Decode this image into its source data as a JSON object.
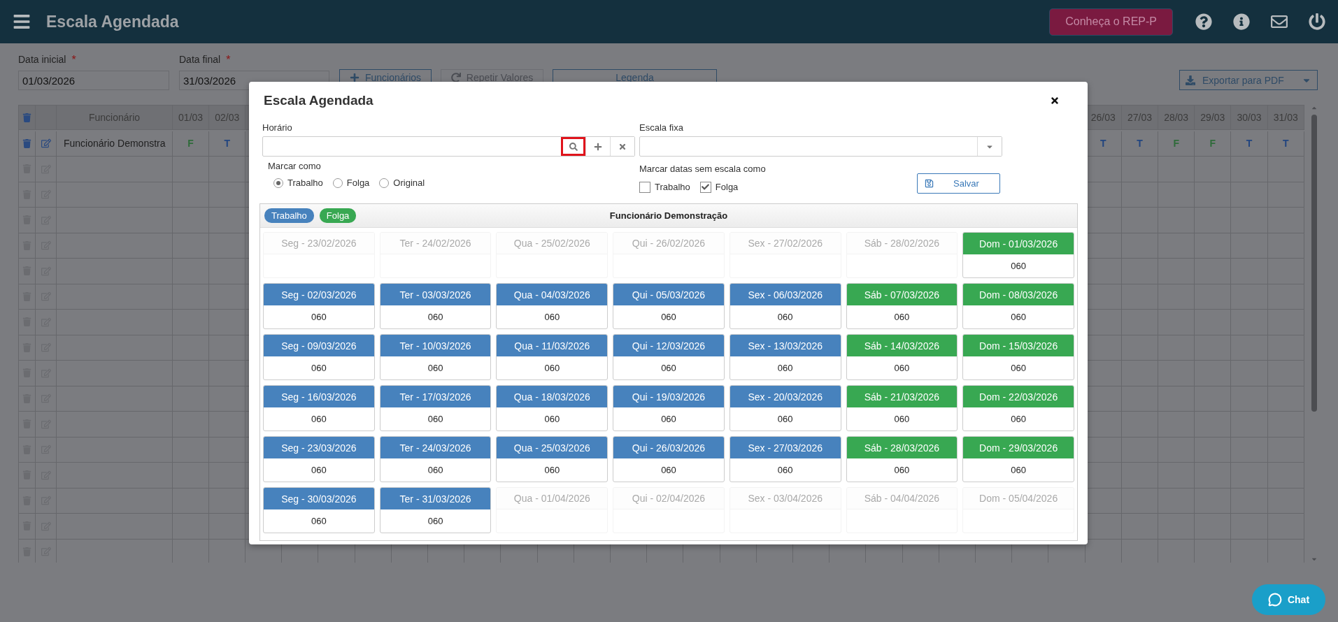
{
  "topbar": {
    "title": "Escala Agendada",
    "promo_button": "Conheça o REP-P"
  },
  "filters": {
    "fields": [
      {
        "label": "Data inicial",
        "required_mark": "*",
        "value": "01/03/2026"
      },
      {
        "label": "Data final",
        "required_mark": "*",
        "value": "31/03/2026"
      }
    ],
    "buttons": [
      {
        "label": "Funcionários",
        "kind": "add",
        "disabled": false
      },
      {
        "label": "Repetir Valores",
        "kind": "repeat",
        "disabled": true
      },
      {
        "label": "Legenda",
        "kind": "plain",
        "disabled": false
      }
    ],
    "export_button": "Exportar para PDF"
  },
  "table": {
    "name_column": "Funcionário",
    "leading_columns": [
      "01/03",
      "02/03"
    ],
    "trailing_columns": [
      "26/03",
      "27/03",
      "28/03",
      "29/03",
      "30/03",
      "31/03"
    ],
    "rows": [
      {
        "name": "Funcionário Demonstra",
        "leading": [
          {
            "text": "F",
            "kind": "folga"
          },
          {
            "text": "T",
            "kind": "trabalho"
          }
        ],
        "trailing": [
          {
            "text": "T",
            "kind": "trabalho"
          },
          {
            "text": "T",
            "kind": "trabalho"
          },
          {
            "text": "F",
            "kind": "folga"
          },
          {
            "text": "F",
            "kind": "folga"
          },
          {
            "text": "T",
            "kind": "trabalho"
          },
          {
            "text": "T",
            "kind": "trabalho"
          }
        ]
      }
    ]
  },
  "modal": {
    "title": "Escala Agendada",
    "horario": {
      "label": "Horário",
      "search_highlighted": true
    },
    "escala_fixa": {
      "label": "Escala fixa"
    },
    "marcar_como": {
      "label": "Marcar como",
      "options": [
        {
          "label": "Trabalho",
          "selected": true
        },
        {
          "label": "Folga",
          "selected": false
        },
        {
          "label": "Original",
          "selected": false
        }
      ]
    },
    "marcar_sem_escala": {
      "label": "Marcar datas sem escala como",
      "options": [
        {
          "label": "Trabalho",
          "checked": false
        },
        {
          "label": "Folga",
          "checked": true
        }
      ]
    },
    "save_button": "Salvar",
    "calendar": {
      "legend": [
        {
          "label": "Trabalho",
          "kind": "trabalho"
        },
        {
          "label": "Folga",
          "kind": "folga"
        }
      ],
      "employee": "Funcionário Demonstração",
      "days": [
        {
          "label": "Seg - 23/02/2026",
          "kind": "outside"
        },
        {
          "label": "Ter - 24/02/2026",
          "kind": "outside"
        },
        {
          "label": "Qua - 25/02/2026",
          "kind": "outside"
        },
        {
          "label": "Qui - 26/02/2026",
          "kind": "outside"
        },
        {
          "label": "Sex - 27/02/2026",
          "kind": "outside"
        },
        {
          "label": "Sáb - 28/02/2026",
          "kind": "outside"
        },
        {
          "label": "Dom - 01/03/2026",
          "kind": "folga",
          "value": "060"
        },
        {
          "label": "Seg - 02/03/2026",
          "kind": "trabalho",
          "value": "060"
        },
        {
          "label": "Ter - 03/03/2026",
          "kind": "trabalho",
          "value": "060"
        },
        {
          "label": "Qua - 04/03/2026",
          "kind": "trabalho",
          "value": "060"
        },
        {
          "label": "Qui - 05/03/2026",
          "kind": "trabalho",
          "value": "060"
        },
        {
          "label": "Sex - 06/03/2026",
          "kind": "trabalho",
          "value": "060"
        },
        {
          "label": "Sáb - 07/03/2026",
          "kind": "folga",
          "value": "060"
        },
        {
          "label": "Dom - 08/03/2026",
          "kind": "folga",
          "value": "060"
        },
        {
          "label": "Seg - 09/03/2026",
          "kind": "trabalho",
          "value": "060"
        },
        {
          "label": "Ter - 10/03/2026",
          "kind": "trabalho",
          "value": "060"
        },
        {
          "label": "Qua - 11/03/2026",
          "kind": "trabalho",
          "value": "060"
        },
        {
          "label": "Qui - 12/03/2026",
          "kind": "trabalho",
          "value": "060"
        },
        {
          "label": "Sex - 13/03/2026",
          "kind": "trabalho",
          "value": "060"
        },
        {
          "label": "Sáb - 14/03/2026",
          "kind": "folga",
          "value": "060"
        },
        {
          "label": "Dom - 15/03/2026",
          "kind": "folga",
          "value": "060"
        },
        {
          "label": "Seg - 16/03/2026",
          "kind": "trabalho",
          "value": "060"
        },
        {
          "label": "Ter - 17/03/2026",
          "kind": "trabalho",
          "value": "060"
        },
        {
          "label": "Qua - 18/03/2026",
          "kind": "trabalho",
          "value": "060"
        },
        {
          "label": "Qui - 19/03/2026",
          "kind": "trabalho",
          "value": "060"
        },
        {
          "label": "Sex - 20/03/2026",
          "kind": "trabalho",
          "value": "060"
        },
        {
          "label": "Sáb - 21/03/2026",
          "kind": "folga",
          "value": "060"
        },
        {
          "label": "Dom - 22/03/2026",
          "kind": "folga",
          "value": "060"
        },
        {
          "label": "Seg - 23/03/2026",
          "kind": "trabalho",
          "value": "060"
        },
        {
          "label": "Ter - 24/03/2026",
          "kind": "trabalho",
          "value": "060"
        },
        {
          "label": "Qua - 25/03/2026",
          "kind": "trabalho",
          "value": "060"
        },
        {
          "label": "Qui - 26/03/2026",
          "kind": "trabalho",
          "value": "060"
        },
        {
          "label": "Sex - 27/03/2026",
          "kind": "trabalho",
          "value": "060"
        },
        {
          "label": "Sáb - 28/03/2026",
          "kind": "folga",
          "value": "060"
        },
        {
          "label": "Dom - 29/03/2026",
          "kind": "folga",
          "value": "060"
        },
        {
          "label": "Seg - 30/03/2026",
          "kind": "trabalho",
          "value": "060"
        },
        {
          "label": "Ter - 31/03/2026",
          "kind": "trabalho",
          "value": "060"
        },
        {
          "label": "Qua - 01/04/2026",
          "kind": "outside"
        },
        {
          "label": "Qui - 02/04/2026",
          "kind": "outside"
        },
        {
          "label": "Sex - 03/04/2026",
          "kind": "outside"
        },
        {
          "label": "Sáb - 04/04/2026",
          "kind": "outside"
        },
        {
          "label": "Dom - 05/04/2026",
          "kind": "outside"
        }
      ]
    }
  },
  "chat_button": "Chat"
}
